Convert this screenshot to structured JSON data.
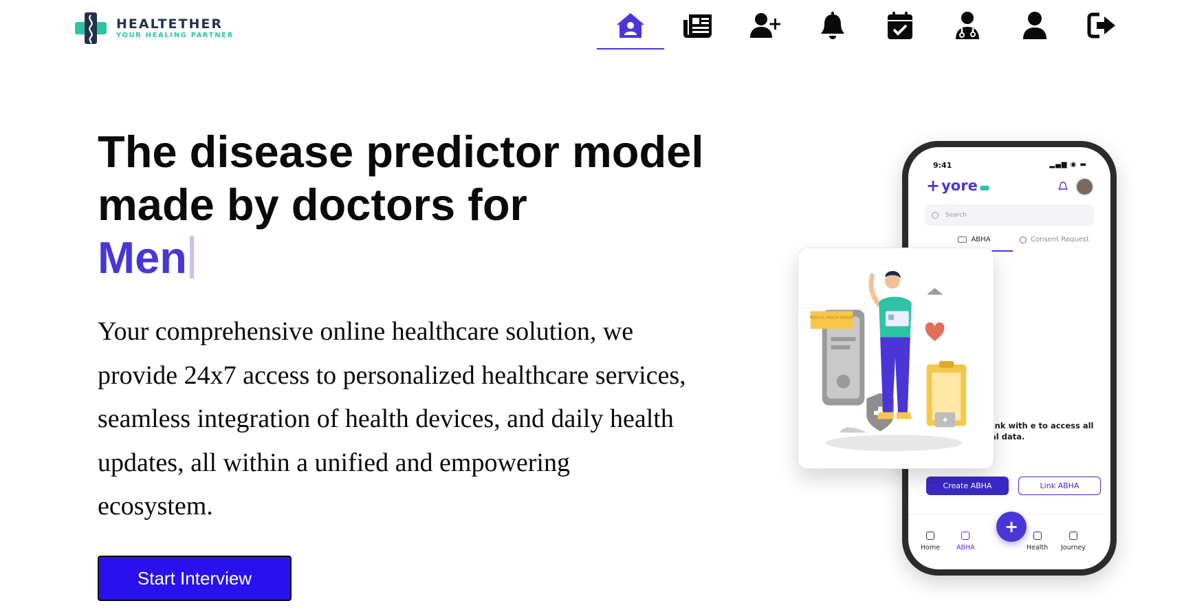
{
  "brand": {
    "name": "HEALTETHER",
    "tagline": "YOUR HEALING PARTNER",
    "colors": {
      "dark": "#23324a",
      "teal": "#2fc3a6"
    }
  },
  "nav": {
    "items": [
      {
        "icon": "home-icon",
        "active": true
      },
      {
        "icon": "newspaper-icon",
        "active": false
      },
      {
        "icon": "user-plus-icon",
        "active": false
      },
      {
        "icon": "bell-icon",
        "active": false
      },
      {
        "icon": "calendar-check-icon",
        "active": false
      },
      {
        "icon": "doctor-icon",
        "active": false
      },
      {
        "icon": "user-icon",
        "active": false
      },
      {
        "icon": "sign-out-icon",
        "active": false
      }
    ],
    "active_color": "#4b35d9"
  },
  "hero": {
    "headline": "The disease predictor model made by doctors for",
    "headline_accent": "Men",
    "accent_color": "#4a36d6",
    "description": "Your comprehensive online healthcare solution, we provide 24x7 access to personalized healthcare services, seamless integration of health devices, and daily health updates, all within a unified and empowering ecosystem.",
    "cta_label": "Start Interview",
    "cta_color": "#2a10ee"
  },
  "phone": {
    "time": "9:41",
    "app_name": "yore",
    "search_placeholder": "Search",
    "tabs": [
      "ABHA",
      "Consent Request"
    ],
    "body_text": "ABHA or link with e to access all your edical data.",
    "buttons": {
      "create": "Create ABHA",
      "link": "Link ABHA"
    },
    "bottom_nav": [
      "Home",
      "ABHA",
      "Health",
      "Journey"
    ]
  },
  "illustration": {
    "labels": [
      "MEDICAL HEALTH REPORT"
    ]
  }
}
